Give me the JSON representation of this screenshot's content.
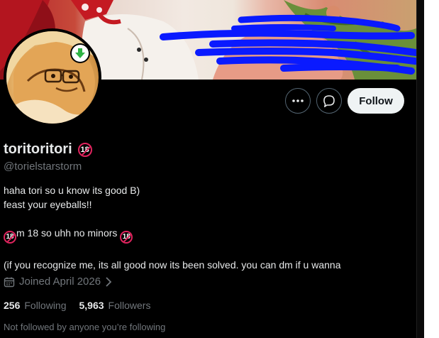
{
  "header": {
    "banner_alt": "profile banner",
    "avatar_alt": "profile avatar"
  },
  "actions": {
    "more_icon": "more-horizontal-icon",
    "message_icon": "message-bubble-icon",
    "follow_label": "Follow"
  },
  "profile": {
    "display_name": "toritoritori",
    "age_badge_text": "18",
    "handle": "@torielstarstorm",
    "bio_line_1": "haha tori so u know its good B)",
    "bio_line_2": "feast your eyeballs!!",
    "bio_line_3_badge": "18",
    "bio_line_3_text": "m 18 so uhh no minors ",
    "bio_line_3_badge_end": "18",
    "bio_line_4": "(if you recognize me, its all good now its been solved. you can dm if u wanna",
    "joined_icon": "calendar-icon",
    "joined": "Joined April 2026",
    "joined_chevron": "chevron-right-icon"
  },
  "stats": {
    "following_count": "256",
    "following_label": "Following",
    "followers_count": "5,963",
    "followers_label": "Followers"
  },
  "social_context": {
    "text": "Not followed by anyone you’re following"
  },
  "colors": {
    "background": "#000000",
    "primary_text": "#e7e9ea",
    "secondary_text": "#71767b",
    "follow_button_bg": "#eff3f4",
    "age_badge_ring": "#e0245e",
    "scribble_blue": "#0a1aff"
  }
}
